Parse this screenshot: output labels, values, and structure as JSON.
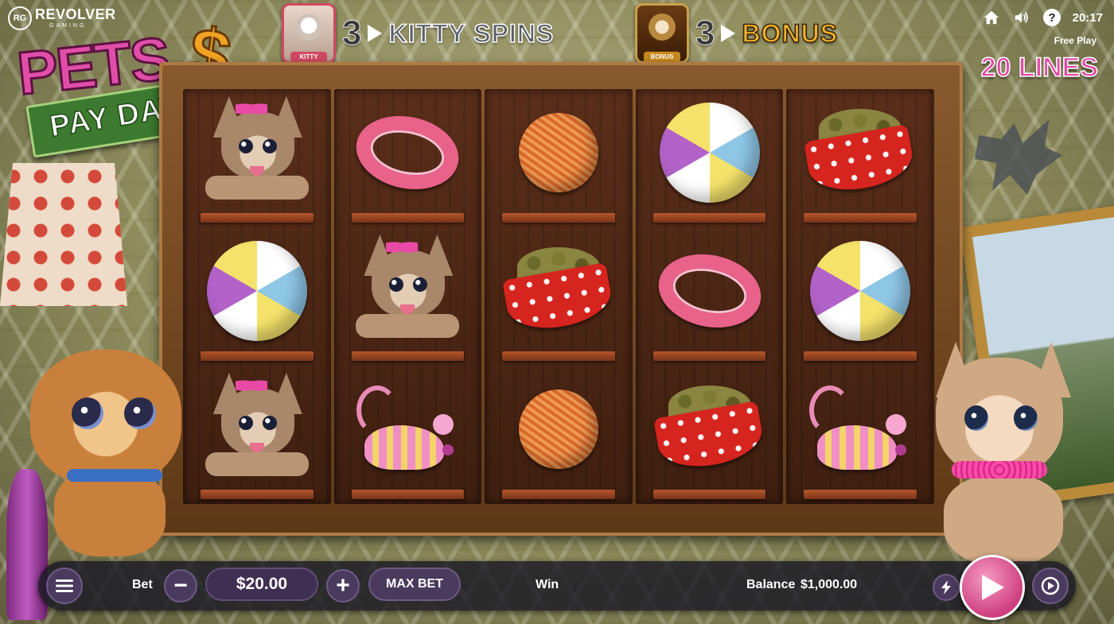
{
  "brand": {
    "name": "REVOLVER",
    "sub": "GAMING",
    "mark": "RG"
  },
  "logo": {
    "title": "PETS",
    "dollar": "$",
    "subtitle": "PAY DAY"
  },
  "features": [
    {
      "badge": "KITTY",
      "count": "3",
      "label": "KITTY SPINS"
    },
    {
      "badge": "BONUS",
      "count": "3",
      "label": "BONUS"
    }
  ],
  "topbar": {
    "time": "20:17",
    "mode": "Free Play",
    "lines": "20 LINES",
    "icons": [
      "home-icon",
      "sound-icon",
      "help-icon"
    ]
  },
  "reels": [
    [
      "dog",
      "ball",
      "dog"
    ],
    [
      "collar",
      "dog",
      "mouse"
    ],
    [
      "yarn",
      "bowl",
      "yarn"
    ],
    [
      "ball",
      "collar",
      "bowl"
    ],
    [
      "bowl",
      "ball",
      "mouse"
    ]
  ],
  "controls": {
    "bet_label": "Bet",
    "bet_value": "$20.00",
    "minus": "−",
    "plus": "+",
    "max_bet": "MAX BET",
    "win_label": "Win",
    "balance_label": "Balance",
    "balance_value": "$1,000.00"
  },
  "colors": {
    "accent": "#e04ea8",
    "bonus": "#f2b32d",
    "bar": "#191923"
  }
}
